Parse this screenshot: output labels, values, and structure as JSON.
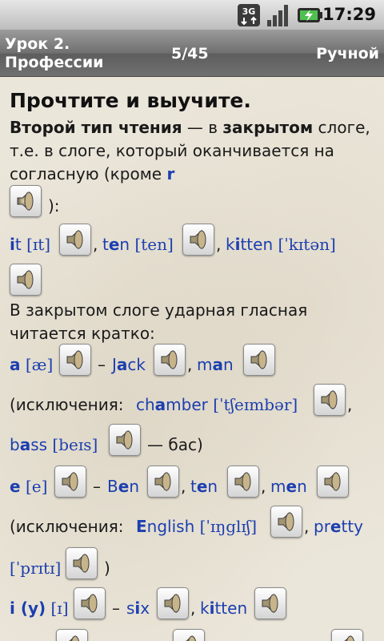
{
  "status_bar": {
    "network": "3G",
    "time": "17:29",
    "icons": [
      "3g-icon",
      "signal-icon",
      "battery-charging-icon"
    ]
  },
  "title_bar": {
    "title_line1": "Урок 2.",
    "title_line2": "Профессии",
    "counter": "5/45",
    "mode": "Ручной"
  },
  "content": {
    "heading": "Прочтите и выучите.",
    "intro_bold1": "Второй тип чтения",
    "intro_text1": " — в ",
    "intro_bold2": "закрытом",
    "intro_text2": " слоге, т.е. в слоге, который оканчивается на согласную (кроме ",
    "intro_r": "r",
    "intro_close": "):",
    "row1": {
      "w1_a": "i",
      "w1_b": "t",
      "w1_ipa": "[ɪt]",
      "comma1": ",",
      "w2_a": "t",
      "w2_b": "e",
      "w2_c": "n",
      "w2_ipa": "[ten]",
      "comma2": ",",
      "w3_a": "k",
      "w3_b": "i",
      "w3_c": "tten",
      "w3_ipa": "[ˈkɪtən]"
    },
    "closed_text": "В закрытом слоге ударная гласная читается кратко:",
    "row_a": {
      "letter": "a",
      "ipa": "[æ]",
      "dash": "–",
      "w1_a": "J",
      "w1_b": "a",
      "w1_c": "ck",
      "comma": ",",
      "w2_a": "m",
      "w2_b": "a",
      "w2_c": "n"
    },
    "exc1": {
      "prefix": "(исключения: ",
      "w1_a": "ch",
      "w1_b": "a",
      "w1_c": "mber",
      "ipa": "[ˈtʃeɪmbər]",
      "comma": ","
    },
    "bass": {
      "w_a": "b",
      "w_b": "a",
      "w_c": "ss",
      "ipa": "[beɪs]",
      "suffix": "— бас)"
    },
    "row_e": {
      "letter": "e",
      "ipa": "[e]",
      "dash": "–",
      "w1_a": "B",
      "w1_b": "e",
      "w1_c": "n",
      "comma1": ",",
      "w2_a": "t",
      "w2_b": "e",
      "w2_c": "n",
      "comma2": ",",
      "w3_a": "m",
      "w3_b": "e",
      "w3_c": "n"
    },
    "exc2": {
      "prefix": "(исключения: ",
      "w1_a": "E",
      "w1_b": "nglish",
      "ipa": "[ˈɪŋglɪʃ]",
      "comma": ",",
      "w2_a": "pr",
      "w2_b": "e",
      "w2_c": "tty"
    },
    "pretty_ipa": {
      "ipa": "[ˈprɪtɪ]",
      "close": ")"
    },
    "row_i": {
      "letter": "i (y)",
      "ipa": "[ɪ]",
      "dash": "–",
      "w1_a": "s",
      "w1_b": "i",
      "w1_c": "x",
      "comma": ",",
      "w2_a": "k",
      "w2_b": "i",
      "w2_c": "tten"
    }
  },
  "colors": {
    "link_blue": "#1c3fb0",
    "titlebar_gray": "#6f6f6f",
    "background": "#ebe6da"
  }
}
